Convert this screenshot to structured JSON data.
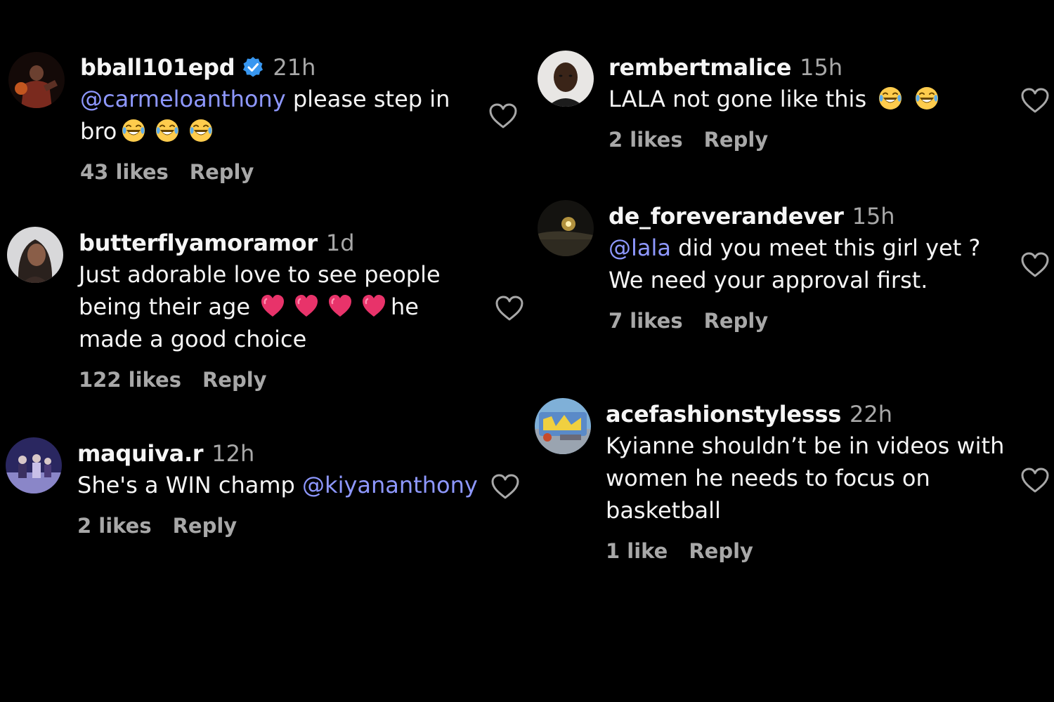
{
  "colors": {
    "background": "#000000",
    "text": "#f5f5f5",
    "muted": "#a8a8a8",
    "mention": "#8e98ff",
    "verified": "#3897f0"
  },
  "comments": [
    {
      "username": "bball101epd",
      "verified": true,
      "time": "21h",
      "mention": "@carmeloanthony",
      "text_after_mention": " please step in",
      "text_line2": "bro",
      "emoji": "laughing-tears-emoji",
      "likes": "43 likes",
      "reply": "Reply"
    },
    {
      "username": "butterflyamoramor",
      "time": "1d",
      "text_line1": "Just adorable love to see people",
      "text_line2a": "being their age",
      "text_line2b": "he",
      "text_line3": "made a good choice",
      "emoji": "heart-emoji",
      "likes": "122 likes",
      "reply": "Reply"
    },
    {
      "username": "maquiva.r",
      "time": "12h",
      "text_before_mention": "She's a WIN champ ",
      "mention": "@kiyananthony",
      "likes": "2 likes",
      "reply": "Reply"
    },
    {
      "username": "rembertmalice",
      "time": "15h",
      "text": "LALA not gone like this",
      "emoji": "laughing-tears-emoji",
      "likes": "2 likes",
      "reply": "Reply"
    },
    {
      "username": "de_foreverandever",
      "time": "15h",
      "mention": "@lala",
      "text_after_mention": " did you meet this girl yet ?",
      "text_line2": "We need your approval first.",
      "likes": "7 likes",
      "reply": "Reply"
    },
    {
      "username": "acefashionstylesss",
      "time": "22h",
      "text_line1": "Kyianne shouldn’t be in videos with",
      "text_line2": "women he needs to focus on",
      "text_line3": "basketball",
      "likes": "1 like",
      "reply": "Reply"
    }
  ]
}
